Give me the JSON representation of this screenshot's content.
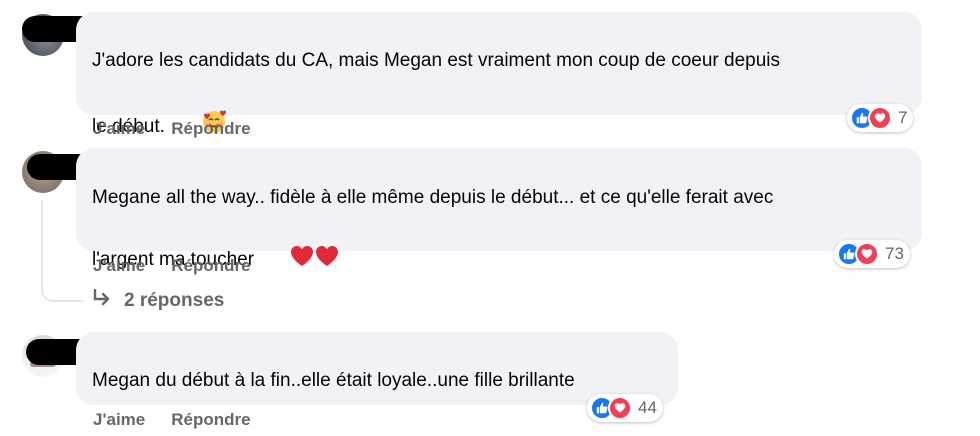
{
  "comments": [
    {
      "text_line1": "J'adore les candidats du CA, mais Megan est vraiment mon coup de coeur depuis",
      "text_line2": "le début.",
      "emoji": "smiling-face-with-hearts",
      "like_label": "J'aime",
      "reply_label": "Répondre",
      "reaction_count": "7"
    },
    {
      "text_line1": "Megane all the way.. fidèle à elle même depuis le début... et ce qu'elle ferait avec",
      "text_line2": "l'argent ma toucher",
      "emoji": "two-red-hearts",
      "like_label": "J'aime",
      "reply_label": "Répondre",
      "reaction_count": "73",
      "replies_label": "2 réponses"
    },
    {
      "text_line1": "Megan du début à la fin..elle était loyale..une fille brillante",
      "like_label": "J'aime",
      "reply_label": "Répondre",
      "reaction_count": "44"
    }
  ],
  "colors": {
    "bubble": "#f0f2f5",
    "secondary_text": "#65676b",
    "like_blue": "#1877f2",
    "love_red": "#f33e58"
  }
}
